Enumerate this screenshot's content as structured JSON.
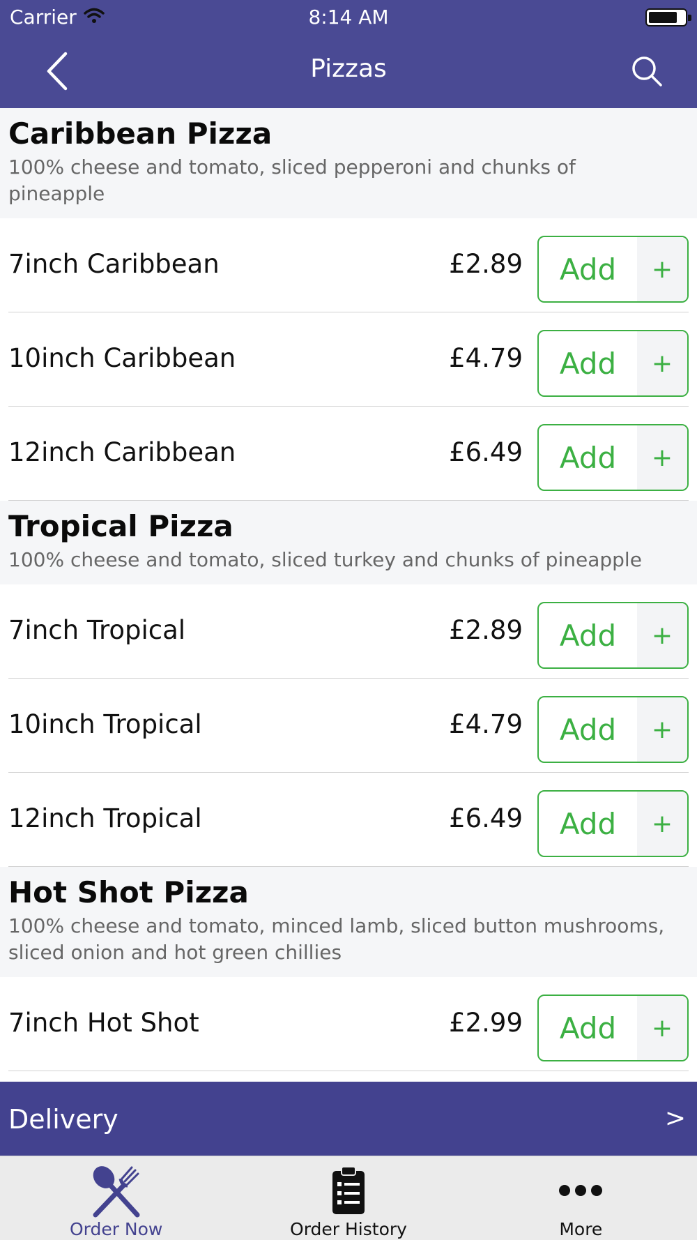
{
  "status_bar": {
    "carrier": "Carrier",
    "time": "8:14 AM"
  },
  "nav": {
    "title": "Pizzas"
  },
  "sections": [
    {
      "title": "Caribbean Pizza",
      "description": "100% cheese and tomato, sliced pepperoni and chunks of pineapple",
      "items": [
        {
          "name": "7inch Caribbean",
          "price": "£2.89",
          "add_label": "Add",
          "plus": "+"
        },
        {
          "name": "10inch Caribbean",
          "price": "£4.79",
          "add_label": "Add",
          "plus": "+"
        },
        {
          "name": "12inch Caribbean",
          "price": "£6.49",
          "add_label": "Add",
          "plus": "+"
        }
      ]
    },
    {
      "title": "Tropical Pizza",
      "description": "100% cheese and tomato, sliced turkey and chunks of pineapple",
      "items": [
        {
          "name": "7inch Tropical",
          "price": "£2.89",
          "add_label": "Add",
          "plus": "+"
        },
        {
          "name": "10inch Tropical",
          "price": "£4.79",
          "add_label": "Add",
          "plus": "+"
        },
        {
          "name": "12inch Tropical",
          "price": "£6.49",
          "add_label": "Add",
          "plus": "+"
        }
      ]
    },
    {
      "title": "Hot Shot Pizza",
      "description": "100% cheese and tomato, minced lamb, sliced button mushrooms, sliced onion and hot green chillies",
      "items": [
        {
          "name": "7inch Hot Shot",
          "price": "£2.99",
          "add_label": "Add",
          "plus": "+"
        }
      ]
    }
  ],
  "delivery": {
    "label": "Delivery",
    "chevron": ">"
  },
  "tabs": [
    {
      "label": "Order Now",
      "icon": "fork-knife-icon",
      "active": true
    },
    {
      "label": "Order History",
      "icon": "clipboard-icon",
      "active": false
    },
    {
      "label": "More",
      "icon": "more-dots-icon",
      "active": false
    }
  ],
  "colors": {
    "header": "#4a4a94",
    "delivery_bar": "#43428f",
    "add_green": "#3cb043",
    "section_bg": "#f5f6f8",
    "tab_active": "#43428f"
  }
}
